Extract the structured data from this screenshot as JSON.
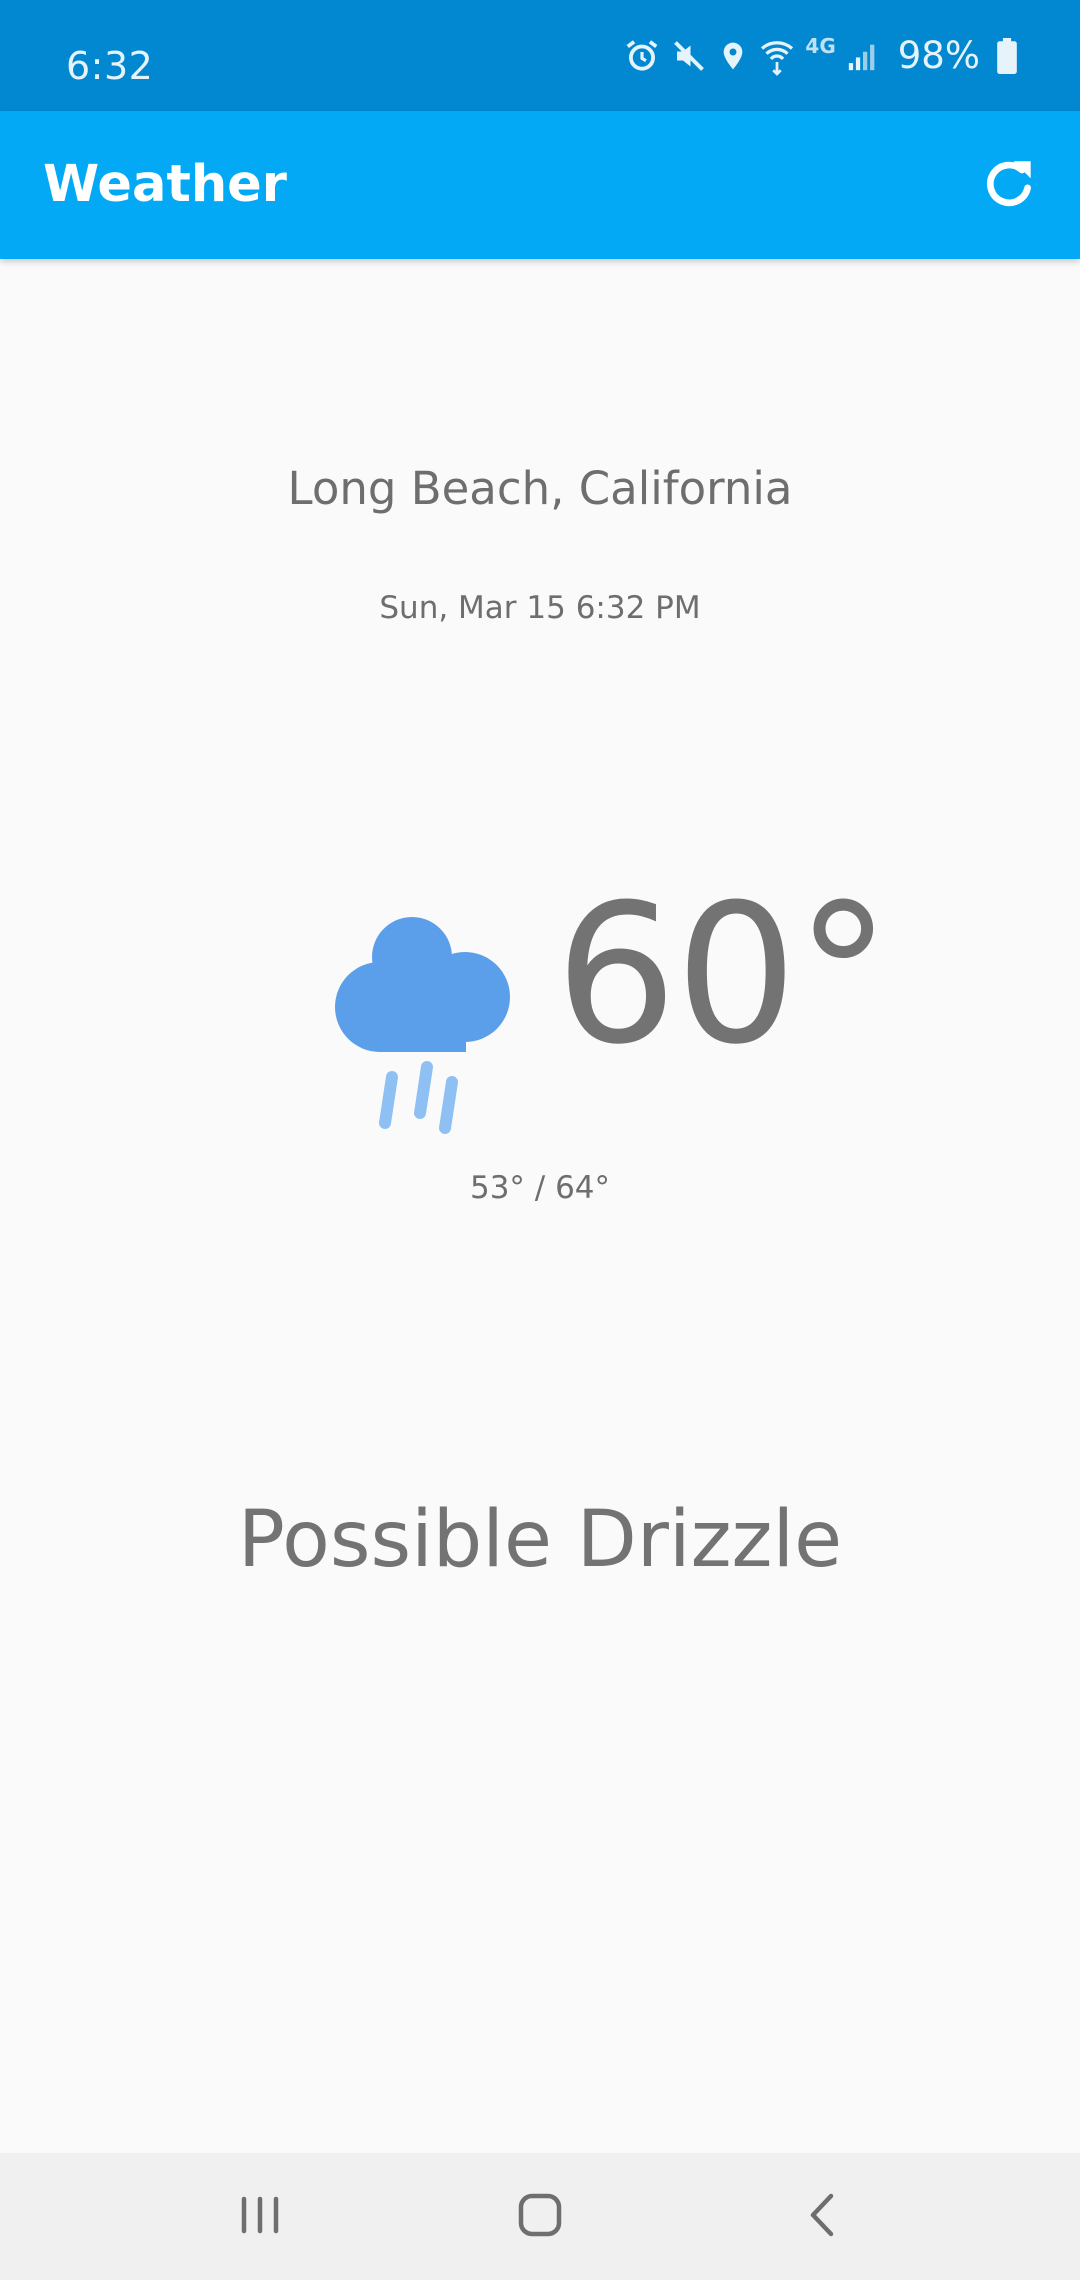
{
  "status_bar": {
    "time": "6:32",
    "battery": "98%",
    "network": "4G",
    "icons": [
      "alarm-icon",
      "mute-icon",
      "location-icon",
      "wifi-icon",
      "network-4g-icon",
      "signal-icon",
      "battery-icon"
    ]
  },
  "app_bar": {
    "title": "Weather",
    "action_icon": "refresh-icon",
    "color": "#03a9f4"
  },
  "weather": {
    "location": "Long Beach, California",
    "datetime": "Sun, Mar 15 6:32 PM",
    "temperature": "60°",
    "low_high": "53° / 64°",
    "summary": "Possible Drizzle",
    "icon": "rain-cloud-icon",
    "icon_color": "#5b9fea"
  },
  "nav_bar": {
    "buttons": [
      "recents-icon",
      "home-icon",
      "back-icon"
    ]
  }
}
